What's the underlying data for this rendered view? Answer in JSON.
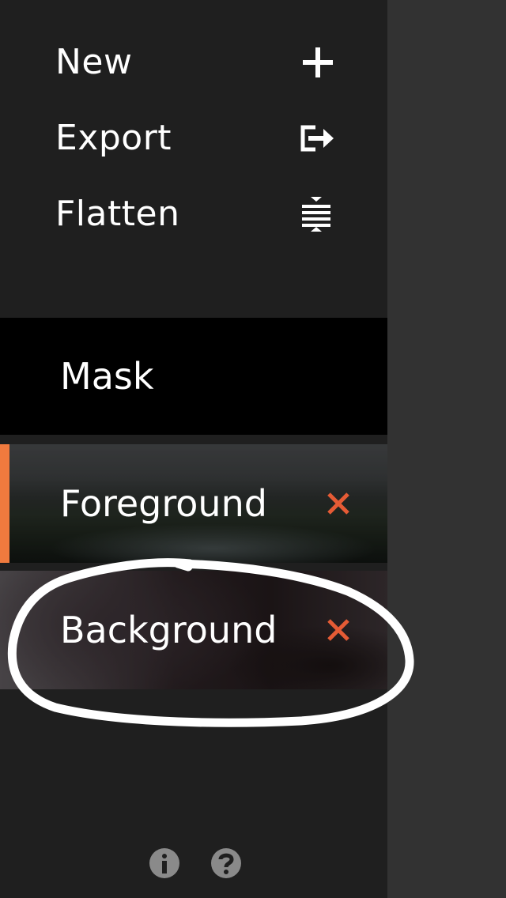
{
  "menu": {
    "items": [
      {
        "label": "New",
        "icon": "plus-icon"
      },
      {
        "label": "Export",
        "icon": "export-icon"
      },
      {
        "label": "Flatten",
        "icon": "flatten-icon"
      }
    ]
  },
  "layers": {
    "mask_label": "Mask",
    "items": [
      {
        "label": "Foreground",
        "active": true,
        "delete_icon": "close-icon"
      },
      {
        "label": "Background",
        "active": false,
        "delete_icon": "close-icon"
      }
    ]
  },
  "footer": {
    "info_icon": "info-icon",
    "help_icon": "help-icon"
  },
  "colors": {
    "accent": "#f07a3e",
    "delete": "#e55b35",
    "panel": "#1f1f1f",
    "background": "#323232"
  }
}
